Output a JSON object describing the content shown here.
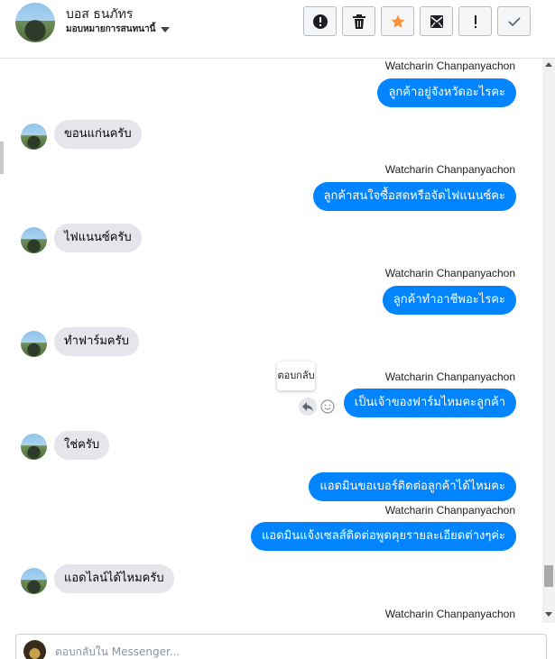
{
  "header": {
    "contact_name": "บอส ธนภัทร",
    "contact_subtitle": "มอบหมายการสนทนานี้",
    "toolbar": [
      {
        "name": "report-button",
        "icon": "exclamation-circle-icon"
      },
      {
        "name": "delete-button",
        "icon": "trash-icon"
      },
      {
        "name": "star-button",
        "icon": "star-icon",
        "color": "#f7923a"
      },
      {
        "name": "mark-unread-button",
        "icon": "envelope-icon"
      },
      {
        "name": "spam-button",
        "icon": "exclamation-icon"
      },
      {
        "name": "done-button",
        "icon": "check-icon"
      }
    ]
  },
  "messages": {
    "sender_name": "Watcharin Chanpanyachon",
    "m1": "ลูกค้าอยู่จังหวัดอะไรคะ",
    "r1": "ขอนแก่นครับ",
    "m2": "ลูกค้าสนใจซื้อสดหรือจัดไฟแนนซ์คะ",
    "r2": "ไฟแนนซ์ครับ",
    "m3": "ลูกค้าทำอาชีพอะไรคะ",
    "r3": "ทำฟาร์มครับ",
    "m4": "เป็นเจ้าของฟาร์มไหมคะลูกค้า",
    "r4": "ใช่ครับ",
    "m5": "แอดมินขอเบอร์ติดต่อลูกค้าได้ไหมคะ",
    "m6": "แอดมินแจ้งเซลส์ติดต่อพูดคุยรายละเอียดต่างๆค่ะ",
    "r5": "แอดไลน์ได้ไหมครับ"
  },
  "tooltip": {
    "reply_label": "ตอบกลับ"
  },
  "composer": {
    "placeholder": "ตอบกลับใน Messenger..."
  },
  "colors": {
    "outgoing_bubble": "#0084ff",
    "incoming_bubble": "#e4e6eb",
    "star_accent": "#f7923a"
  }
}
